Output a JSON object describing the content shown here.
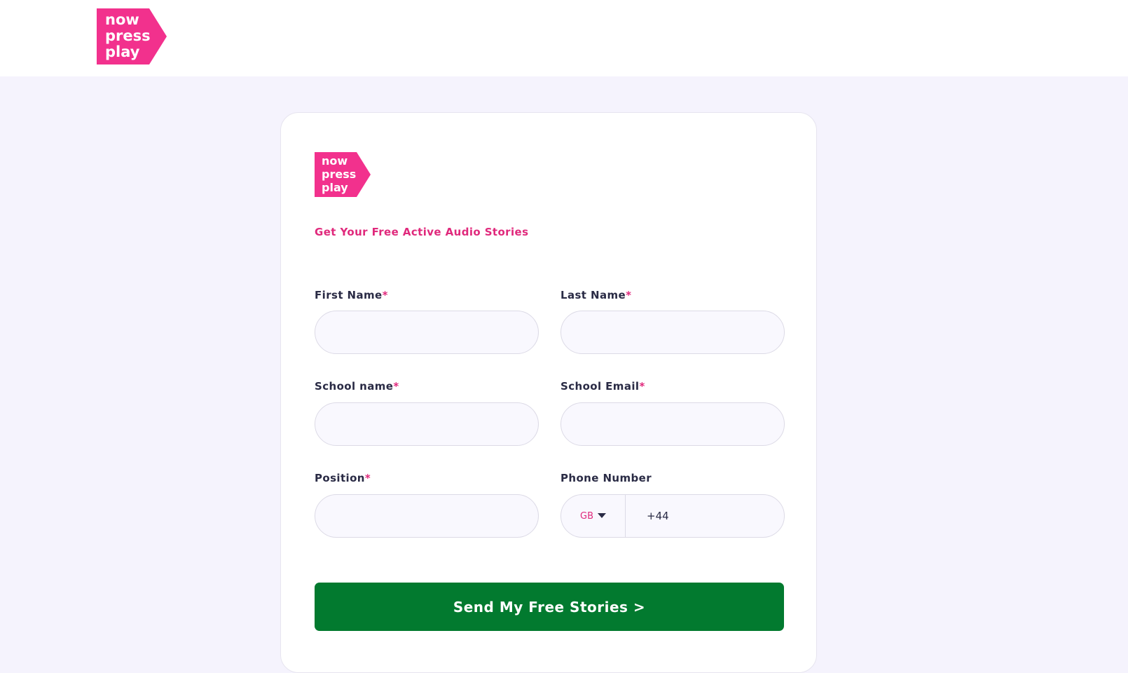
{
  "brand": {
    "logo_lines": [
      "now",
      "press",
      "play"
    ],
    "logo_color": "#f2318d"
  },
  "form": {
    "subtitle": "Get Your Free Active Audio Stories",
    "required_marker": "*",
    "fields": {
      "first_name": {
        "label": "First Name",
        "value": "",
        "placeholder": ""
      },
      "last_name": {
        "label": "Last Name",
        "value": "",
        "placeholder": ""
      },
      "school_name": {
        "label": "School name",
        "value": "",
        "placeholder": ""
      },
      "school_email": {
        "label": "School Email",
        "value": "",
        "placeholder": ""
      },
      "position": {
        "label": "Position",
        "value": "",
        "placeholder": ""
      },
      "phone": {
        "label": "Phone Number",
        "country": "GB",
        "value": "+44"
      }
    },
    "submit_label": "Send My Free Stories >"
  },
  "colors": {
    "accent": "#e0297c",
    "button": "#027a2f",
    "page_bg": "#f5f3fd",
    "text": "#2a2b45"
  }
}
